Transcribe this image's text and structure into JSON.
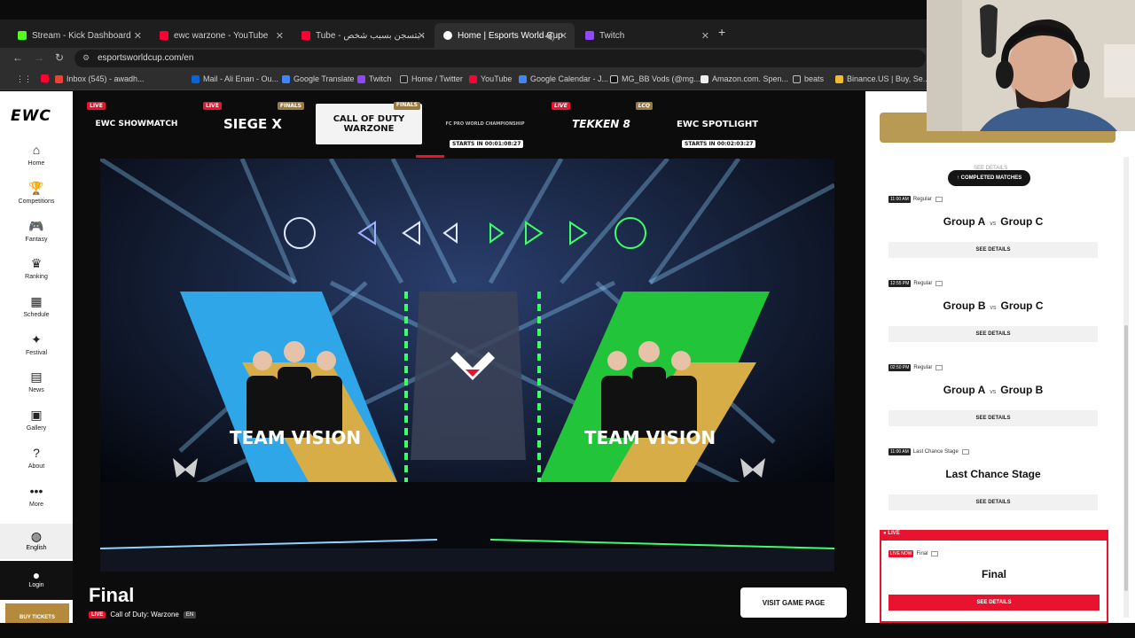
{
  "browser": {
    "tabs": [
      {
        "label": "Stream - Kick Dashboard",
        "color": "#53fc18",
        "active": false
      },
      {
        "label": "ewc warzone - YouTube",
        "color": "#ff0033",
        "active": false
      },
      {
        "label": "Tube - كنت بتسجن بسبب شخص",
        "color": "#ff0033",
        "active": false
      },
      {
        "label": "Home | Esports World Cup",
        "color": "#ffffff",
        "active": true
      },
      {
        "label": "Twitch",
        "color": "#9146ff",
        "active": false
      }
    ],
    "new_tab": "+",
    "url": "esportsworldcup.com/en",
    "bookmarks": [
      {
        "label": "Inbox (545) - awadh...",
        "color": "#ea4335"
      },
      {
        "label": "Mail - Ali Enan - Ou...",
        "color": "#0a64d6"
      },
      {
        "label": "Google Translate",
        "color": "#4285f4"
      },
      {
        "label": "Twitch",
        "color": "#9146ff"
      },
      {
        "label": "Home / Twitter",
        "color": "#ffffff"
      },
      {
        "label": "YouTube",
        "color": "#ff0033"
      },
      {
        "label": "Google Calendar - J...",
        "color": "#4285f4"
      },
      {
        "label": "MG_BB Vods (@mg...",
        "color": "#ffffff"
      },
      {
        "label": "Amazon.com. Spen...",
        "color": "#ffffff"
      },
      {
        "label": "beats",
        "color": "#aaaaaa"
      },
      {
        "label": "Binance.US | Buy, Se...",
        "color": "#f3ba2f"
      }
    ]
  },
  "site": {
    "logo": "EWC",
    "nav": [
      {
        "label": "Home",
        "icon": "⌂"
      },
      {
        "label": "Competitions",
        "icon": "🏆"
      },
      {
        "label": "Fantasy",
        "icon": "🎮"
      },
      {
        "label": "Ranking",
        "icon": "♛"
      },
      {
        "label": "Schedule",
        "icon": "▦"
      },
      {
        "label": "Festival",
        "icon": "✦"
      },
      {
        "label": "News",
        "icon": "▤"
      },
      {
        "label": "Gallery",
        "icon": "▣"
      },
      {
        "label": "About",
        "icon": "?"
      },
      {
        "label": "More",
        "icon": "•••"
      }
    ],
    "language": "English",
    "login": "Login",
    "tickets": "BUY TICKETS",
    "games": [
      {
        "name": "EWC SHOWMATCH",
        "badge": "LIVE",
        "tag": "",
        "starts": ""
      },
      {
        "name": "SIEGE X",
        "badge": "LIVE",
        "tag": "FINALS",
        "starts": ""
      },
      {
        "name": "CALL OF DUTY WARZONE",
        "badge": "",
        "tag": "FINALS",
        "starts": ""
      },
      {
        "name": "FC PRO WORLD CHAMPIONSHIP",
        "badge": "",
        "tag": "",
        "starts": "STARTS IN 00:01:08:27"
      },
      {
        "name": "TEKKEN 8",
        "badge": "LIVE",
        "tag": "LCQ",
        "starts": ""
      },
      {
        "name": "EWC SPOTLIGHT",
        "badge": "",
        "tag": "",
        "starts": "STARTS IN 00:02:03:27"
      }
    ],
    "stage": {
      "left_team": "TEAM VISION",
      "right_team": "TEAM VISION"
    },
    "bottom": {
      "title": "Final",
      "live": "LIVE",
      "game": "Call of Duty: Warzone",
      "lang": "EN",
      "visit": "VISIT GAME PAGE"
    }
  },
  "schedule": {
    "completed_button": "↑ COMPLETED MATCHES",
    "ghost": "SEE DETAILS",
    "matches": [
      {
        "time": "11:00 AM",
        "stage": "Regular",
        "team_a": "Group A",
        "vs": "vs",
        "team_b": "Group C",
        "details": "SEE DETAILS"
      },
      {
        "time": "12:55 PM",
        "stage": "Regular",
        "team_a": "Group B",
        "vs": "vs",
        "team_b": "Group C",
        "details": "SEE DETAILS"
      },
      {
        "time": "02:50 PM",
        "stage": "Regular",
        "team_a": "Group A",
        "vs": "vs",
        "team_b": "Group B",
        "details": "SEE DETAILS"
      },
      {
        "time": "11:00 AM",
        "stage": "Last Chance Stage",
        "title": "Last Chance Stage",
        "details": "SEE DETAILS"
      }
    ],
    "live_header": "● LIVE",
    "live_match": {
      "pill": "LIVE NOW",
      "stage": "Final",
      "title": "Final",
      "details": "SEE DETAILS"
    }
  }
}
